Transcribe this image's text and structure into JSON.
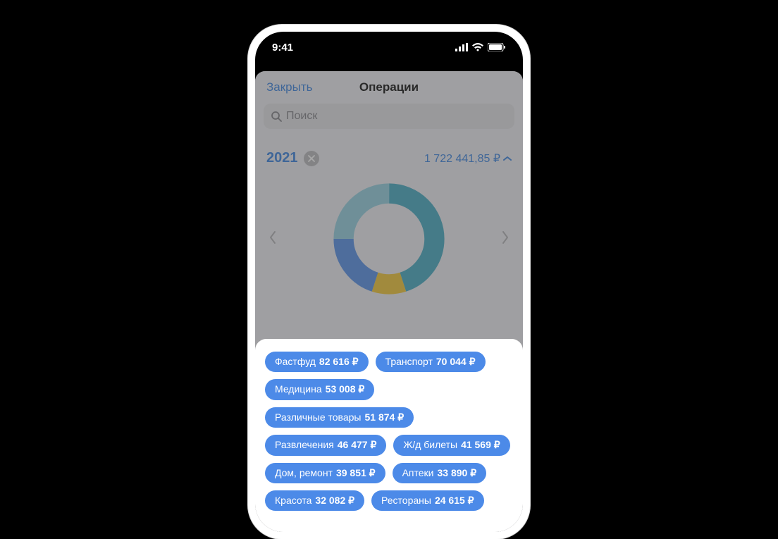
{
  "status": {
    "time": "9:41"
  },
  "nav": {
    "close": "Закрыть",
    "title": "Операции"
  },
  "search": {
    "placeholder": "Поиск"
  },
  "summary": {
    "year": "2021",
    "total": "1 722 441,85 ₽"
  },
  "chart_data": {
    "type": "pie",
    "title": "",
    "series": [
      {
        "name": "teal-segment",
        "value": 45,
        "color": "#3aa6c0"
      },
      {
        "name": "yellow-segment",
        "value": 10,
        "color": "#f2c52b"
      },
      {
        "name": "blue-segment",
        "value": 20,
        "color": "#4c8ae8"
      },
      {
        "name": "light-segment",
        "value": 25,
        "color": "#8fcfe0"
      }
    ]
  },
  "categories": [
    {
      "name": "Фастфуд",
      "amount": "82 616 ₽"
    },
    {
      "name": "Транспорт",
      "amount": "70 044 ₽"
    },
    {
      "name": "Медицина",
      "amount": "53 008 ₽"
    },
    {
      "name": "Различные товары",
      "amount": "51 874 ₽"
    },
    {
      "name": "Развлечения",
      "amount": "46 477 ₽"
    },
    {
      "name": "Ж/д билеты",
      "amount": "41 569 ₽"
    },
    {
      "name": "Дом, ремонт",
      "amount": "39 851 ₽"
    },
    {
      "name": "Аптеки",
      "amount": "33 890 ₽"
    },
    {
      "name": "Красота",
      "amount": "32 082 ₽"
    },
    {
      "name": "Рестораны",
      "amount": "24 615 ₽"
    }
  ]
}
